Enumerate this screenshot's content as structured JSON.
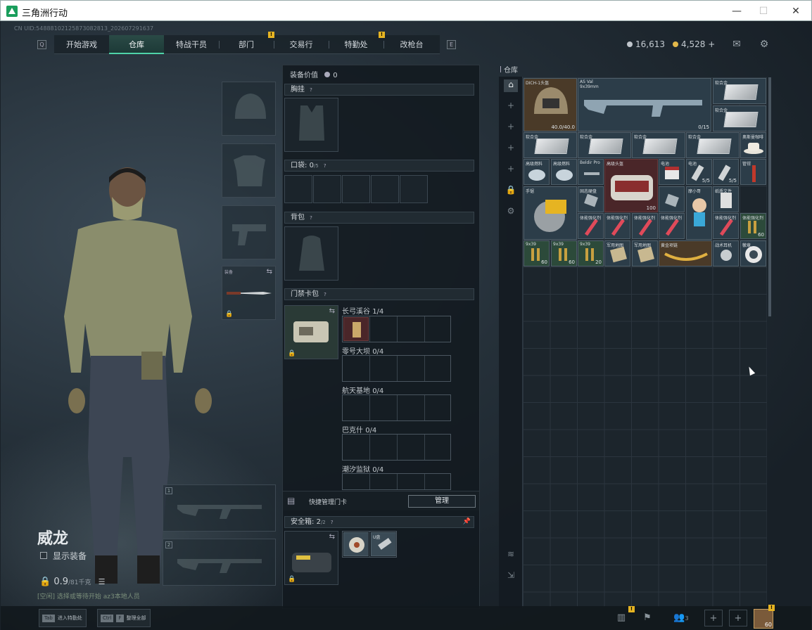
{
  "window": {
    "title": "三角洲行动",
    "minimize": "—",
    "maximize": "☐",
    "close": "✕"
  },
  "uid": "CN UID:54888102125873082813_202607291637",
  "nav": {
    "left_key": "Q",
    "right_key": "E",
    "tabs": [
      "开始游戏",
      "仓库",
      "特战干员",
      "部门",
      "交易行",
      "特勤处",
      "改枪台"
    ],
    "badge": "!"
  },
  "currency": {
    "silver": "16,613",
    "gold": "4,528",
    "plus": "+",
    "silver_color": "#c0c6cc",
    "gold_color": "#e2b84a"
  },
  "header_icons": [
    "mail-icon",
    "gear-icon"
  ],
  "character": {
    "name": "威龙",
    "show_gear_label": "显示装备",
    "weight_value": "0.9",
    "weight_total": "/81千克",
    "status": "[空闲] 选择或等待开始   az3本地人员"
  },
  "weapon_slots": {
    "primary_num": "1",
    "secondary_num": "2",
    "melee_label": "装备"
  },
  "equipment": {
    "value_label": "装备价值",
    "value": "0",
    "chest_label": "胸挂",
    "pocket_label": "口袋:",
    "pocket_count": "0",
    "pocket_max": "/5",
    "backpack_label": "背包",
    "keycard_label": "门禁卡包",
    "keycard_rows": [
      {
        "label": "长弓溪谷",
        "count": "1/4"
      },
      {
        "label": "零号大坝",
        "count": "0/4"
      },
      {
        "label": "航天基地",
        "count": "0/4"
      },
      {
        "label": "巴克什",
        "count": "0/4"
      },
      {
        "label": "潮汐监狱",
        "count": "0/4"
      }
    ],
    "quick_manage_label": "快捷管理门卡",
    "manage_button": "管理",
    "safebox_label": "安全箱:",
    "safebox_count": "2",
    "safebox_max": "/2",
    "safebox_item_label": "U盘",
    "help": "?"
  },
  "warehouse": {
    "title": "仓库",
    "items": [
      {
        "name": "DICH-1头盔",
        "count": "40.0/40.0"
      },
      {
        "name": "AS Val",
        "sub": "9x39mm",
        "count": "0/15"
      },
      {
        "name": "软合金"
      },
      {
        "name": "软合金"
      },
      {
        "name": "软合金"
      },
      {
        "name": "软合金"
      },
      {
        "name": "软合金"
      },
      {
        "name": "软合金"
      },
      {
        "name": "奥斯曼咖啡"
      },
      {
        "name": "高级燃料"
      },
      {
        "name": "高级燃料"
      },
      {
        "name": "Beldir Pro"
      },
      {
        "name": "高级头盔"
      },
      {
        "name": "电池",
        "count": "5/5"
      },
      {
        "name": "电池",
        "count": "5/5"
      },
      {
        "name": "管钳"
      },
      {
        "name": "手锯"
      },
      {
        "name": "固态硬盘"
      },
      {
        "name": "通讯器",
        "count": "100"
      },
      {
        "name": "摩小哥"
      },
      {
        "name": "纸质文件"
      },
      {
        "name": "体能强化剂"
      },
      {
        "name": "体能强化剂"
      },
      {
        "name": "体能强化剂"
      },
      {
        "name": "体能强化剂"
      },
      {
        "name": "体能强化剂"
      },
      {
        "name": "体能强化剂"
      },
      {
        "name": "9x39",
        "count": "60"
      },
      {
        "name": "9x39",
        "count": "60"
      },
      {
        "name": "9x39",
        "count": "60"
      },
      {
        "name": "9x39",
        "count": "20"
      },
      {
        "name": "军用地图"
      },
      {
        "name": "军用地图"
      },
      {
        "name": "黄金项链"
      },
      {
        "name": "战术耳机"
      },
      {
        "name": "徽章"
      }
    ]
  },
  "bottom": {
    "tab_key": "Tab",
    "tab_label": "进入特勤处",
    "ctrl_key": "Ctrl",
    "f_key": "F",
    "ctrl_label": "整理全部",
    "level": "60",
    "friends": "3"
  }
}
